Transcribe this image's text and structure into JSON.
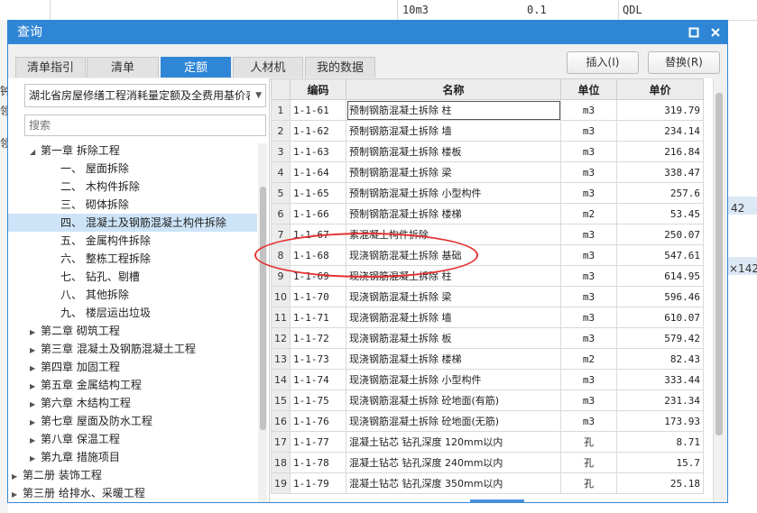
{
  "background": {
    "top_row": [
      "10m3",
      "0.1",
      "QDL"
    ],
    "left_chars": [
      "钟",
      "领",
      "领"
    ],
    "right_values": [
      "42",
      "×142"
    ]
  },
  "dialog": {
    "title": "查询",
    "restore_icon": "restore-icon",
    "close_icon": "close-icon",
    "accent_color": "#2f86d6"
  },
  "tabs": [
    {
      "label": "清单指引",
      "active": false
    },
    {
      "label": "清单",
      "active": false
    },
    {
      "label": "定额",
      "active": true
    },
    {
      "label": "人材机",
      "active": false
    },
    {
      "label": "我的数据",
      "active": false
    }
  ],
  "actions": {
    "insert_label": "插入(I)",
    "replace_label": "替换(R)"
  },
  "left": {
    "dropdown_value": "湖北省房屋修缮工程消耗量定额及全费用基价表",
    "search_placeholder": "搜索",
    "tree": [
      {
        "label": "第一章 拆除工程",
        "expand": "open",
        "level": 2
      },
      {
        "label": "一、 屋面拆除",
        "expand": "none",
        "level": 3
      },
      {
        "label": "二、 木构件拆除",
        "expand": "none",
        "level": 3
      },
      {
        "label": "三、 砌体拆除",
        "expand": "none",
        "level": 3
      },
      {
        "label": "四、 混凝土及钢筋混凝土构件拆除",
        "expand": "none",
        "level": 3,
        "selected": true
      },
      {
        "label": "五、 金属构件拆除",
        "expand": "none",
        "level": 3
      },
      {
        "label": "六、 整栋工程拆除",
        "expand": "none",
        "level": 3
      },
      {
        "label": "七、 钻孔、剔槽",
        "expand": "none",
        "level": 3
      },
      {
        "label": "八、 其他拆除",
        "expand": "none",
        "level": 3
      },
      {
        "label": "九、 楼层运出垃圾",
        "expand": "none",
        "level": 3
      },
      {
        "label": "第二章 砌筑工程",
        "expand": "closed",
        "level": 2
      },
      {
        "label": "第三章 混凝土及钢筋混凝土工程",
        "expand": "closed",
        "level": 2
      },
      {
        "label": "第四章 加固工程",
        "expand": "closed",
        "level": 2
      },
      {
        "label": "第五章 金属结构工程",
        "expand": "closed",
        "level": 2
      },
      {
        "label": "第六章 木结构工程",
        "expand": "closed",
        "level": 2
      },
      {
        "label": "第七章 屋面及防水工程",
        "expand": "closed",
        "level": 2
      },
      {
        "label": "第八章 保温工程",
        "expand": "closed",
        "level": 2
      },
      {
        "label": "第九章 措施项目",
        "expand": "closed",
        "level": 2
      },
      {
        "label": "第二册 装饰工程",
        "expand": "closed",
        "level": 1
      },
      {
        "label": "第三册 给排水、采暖工程",
        "expand": "closed",
        "level": 1
      }
    ]
  },
  "grid": {
    "headers": [
      "",
      "编码",
      "名称",
      "单位",
      "单价"
    ],
    "rows": [
      {
        "n": "1",
        "code": "1-1-61",
        "name": "预制钢筋混凝土拆除 柱",
        "unit": "m3",
        "price": "319.79"
      },
      {
        "n": "2",
        "code": "1-1-62",
        "name": "预制钢筋混凝土拆除 墙",
        "unit": "m3",
        "price": "234.14"
      },
      {
        "n": "3",
        "code": "1-1-63",
        "name": "预制钢筋混凝土拆除 楼板",
        "unit": "m3",
        "price": "216.84"
      },
      {
        "n": "4",
        "code": "1-1-64",
        "name": "预制钢筋混凝土拆除 梁",
        "unit": "m3",
        "price": "338.47"
      },
      {
        "n": "5",
        "code": "1-1-65",
        "name": "预制钢筋混凝土拆除 小型构件",
        "unit": "m3",
        "price": "257.6"
      },
      {
        "n": "6",
        "code": "1-1-66",
        "name": "预制钢筋混凝土拆除 楼梯",
        "unit": "m2",
        "price": "53.45"
      },
      {
        "n": "7",
        "code": "1-1-67",
        "name": "素混凝土构件拆除",
        "unit": "m3",
        "price": "250.07"
      },
      {
        "n": "8",
        "code": "1-1-68",
        "name": "现浇钢筋混凝土拆除 基础",
        "unit": "m3",
        "price": "547.61"
      },
      {
        "n": "9",
        "code": "1-1-69",
        "name": "现浇钢筋混凝土拆除 柱",
        "unit": "m3",
        "price": "614.95"
      },
      {
        "n": "10",
        "code": "1-1-70",
        "name": "现浇钢筋混凝土拆除 梁",
        "unit": "m3",
        "price": "596.46"
      },
      {
        "n": "11",
        "code": "1-1-71",
        "name": "现浇钢筋混凝土拆除 墙",
        "unit": "m3",
        "price": "610.07"
      },
      {
        "n": "12",
        "code": "1-1-72",
        "name": "现浇钢筋混凝土拆除 板",
        "unit": "m3",
        "price": "579.42"
      },
      {
        "n": "13",
        "code": "1-1-73",
        "name": "现浇钢筋混凝土拆除 楼梯",
        "unit": "m2",
        "price": "82.43"
      },
      {
        "n": "14",
        "code": "1-1-74",
        "name": "现浇钢筋混凝土拆除 小型构件",
        "unit": "m3",
        "price": "333.44"
      },
      {
        "n": "15",
        "code": "1-1-75",
        "name": "现浇钢筋混凝土拆除 砼地面(有筋)",
        "unit": "m3",
        "price": "231.34"
      },
      {
        "n": "16",
        "code": "1-1-76",
        "name": "现浇钢筋混凝土拆除 砼地面(无筋)",
        "unit": "m3",
        "price": "173.93"
      },
      {
        "n": "17",
        "code": "1-1-77",
        "name": "混凝土钻芯 钻孔深度 120mm以内",
        "unit": "孔",
        "price": "8.71"
      },
      {
        "n": "18",
        "code": "1-1-78",
        "name": "混凝土钻芯 钻孔深度 240mm以内",
        "unit": "孔",
        "price": "15.7"
      },
      {
        "n": "19",
        "code": "1-1-79",
        "name": "混凝土钻芯 钻孔深度 350mm以内",
        "unit": "孔",
        "price": "25.18"
      }
    ]
  },
  "annotation_color": "#e53030"
}
